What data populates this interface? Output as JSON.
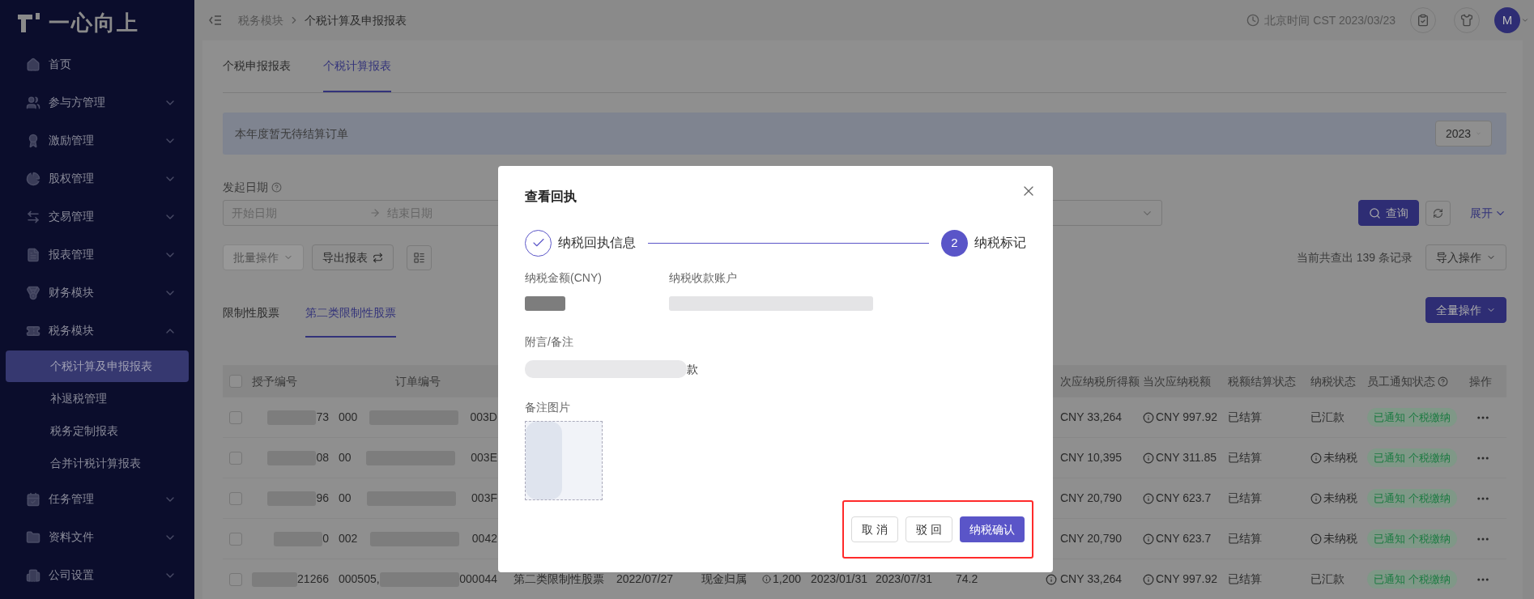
{
  "sidebar": {
    "logo": "一心向上",
    "items": [
      {
        "label": "首页",
        "kind": "link"
      },
      {
        "label": "参与方管理",
        "kind": "group",
        "expanded": false
      },
      {
        "label": "激励管理",
        "kind": "group",
        "expanded": false
      },
      {
        "label": "股权管理",
        "kind": "group",
        "expanded": false
      },
      {
        "label": "交易管理",
        "kind": "group",
        "expanded": false
      },
      {
        "label": "报表管理",
        "kind": "group",
        "expanded": false
      },
      {
        "label": "财务模块",
        "kind": "group",
        "expanded": false
      },
      {
        "label": "税务模块",
        "kind": "group",
        "expanded": true,
        "children": [
          {
            "label": "个税计算及申报报表",
            "selected": true
          },
          {
            "label": "补退税管理",
            "selected": false
          },
          {
            "label": "税务定制报表",
            "selected": false
          },
          {
            "label": "合并计税计算报表",
            "selected": false
          }
        ]
      },
      {
        "label": "任务管理",
        "kind": "group",
        "expanded": false
      },
      {
        "label": "资料文件",
        "kind": "group",
        "expanded": false
      },
      {
        "label": "公司设置",
        "kind": "group",
        "expanded": false
      }
    ]
  },
  "header": {
    "breadcrumb": [
      "税务模块",
      "个税计算及申报报表"
    ],
    "clock": "北京时间 CST 2023/03/23",
    "avatar": "M"
  },
  "tabs": [
    {
      "label": "个税申报报表",
      "selected": false
    },
    {
      "label": "个税计算报表",
      "selected": true
    }
  ],
  "banner": {
    "text": "本年度暂无待结算订单",
    "year": "2023"
  },
  "filters": {
    "date_label": "发起日期",
    "start_placeholder": "开始日期",
    "end_placeholder": "结束日期",
    "query": "查询",
    "expand": "展开"
  },
  "toolbar": {
    "batch": {
      "label": "批量操作",
      "disabled": true
    },
    "export": "导出报表",
    "record_count": "当前共查出 139 条记录",
    "import": "导入操作"
  },
  "subtabs": [
    {
      "label": "限制性股票",
      "selected": false
    },
    {
      "label": "第二类限制性股票",
      "selected": true
    }
  ],
  "all_ops": "全量操作",
  "table": {
    "checked": false,
    "columns": {
      "grant_no": "授予编号",
      "order_no": "订单编号",
      "income": "次应纳税所得额",
      "tax": "当次应纳税额",
      "settle": "税额结算状态",
      "pay": "纳税状态",
      "notice": "员工通知状态",
      "ops": "操作"
    },
    "rows": [
      {
        "checked": false,
        "grant_no": "73",
        "order_head": "000",
        "order_tail": "003D",
        "income": "CNY 33,264",
        "tax": "CNY 997.92",
        "settle": "已结算",
        "pay": {
          "text": "已汇款",
          "kind": "paid"
        },
        "notice": "已通知 个税缴纳"
      },
      {
        "checked": false,
        "grant_no": "08",
        "order_head": "00",
        "order_tail": "003E",
        "income": "CNY 10,395",
        "tax": "CNY 311.85",
        "settle": "已结算",
        "pay": {
          "text": "未纳税",
          "kind": "unpaid"
        },
        "notice": "已通知 个税缴纳"
      },
      {
        "checked": false,
        "grant_no": "96",
        "order_head": "00",
        "order_tail": "003F",
        "income": "CNY 20,790",
        "tax": "CNY 623.7",
        "settle": "已结算",
        "pay": {
          "text": "未纳税",
          "kind": "unpaid"
        },
        "notice": "已通知 个税缴纳"
      },
      {
        "checked": false,
        "grant_no": "0",
        "order_head": "002",
        "order_tail": "0042",
        "income": "CNY 20,790",
        "tax": "CNY 623.7",
        "settle": "已结算",
        "pay": {
          "text": "未纳税",
          "kind": "unpaid"
        },
        "notice": "已通知 个税缴纳"
      },
      {
        "checked": false,
        "grant_no": "21266",
        "order_head": "000505,",
        "order_tail": "000044",
        "type": "第二类限制性股票",
        "date": "2022/07/27",
        "method": "现金归属",
        "qty": "1,200",
        "date_1": "2023/01/31",
        "date_2": "2023/07/31",
        "num": "74.2",
        "income_info": true,
        "income": "CNY 33,264",
        "tax": "CNY 997.92",
        "settle": "已结算",
        "pay": {
          "text": "已汇款",
          "kind": "paid"
        },
        "notice": "已通知 个税缴纳"
      }
    ]
  },
  "modal": {
    "title": "查看回执",
    "steps": [
      {
        "label": "纳税回执信息",
        "done": true
      },
      {
        "label": "纳税标记",
        "number": "2",
        "done": false
      }
    ],
    "fields": [
      {
        "label": "纳税金额(CNY)"
      },
      {
        "label": "纳税收款账户"
      }
    ],
    "note_label": "附言/备注",
    "note_tail": "款",
    "image_label": "备注图片",
    "buttons": [
      {
        "label": "取 消",
        "kind": "default"
      },
      {
        "label": "驳 回",
        "kind": "default"
      },
      {
        "label": "纳税确认",
        "kind": "primary"
      }
    ],
    "highlighted": true
  }
}
